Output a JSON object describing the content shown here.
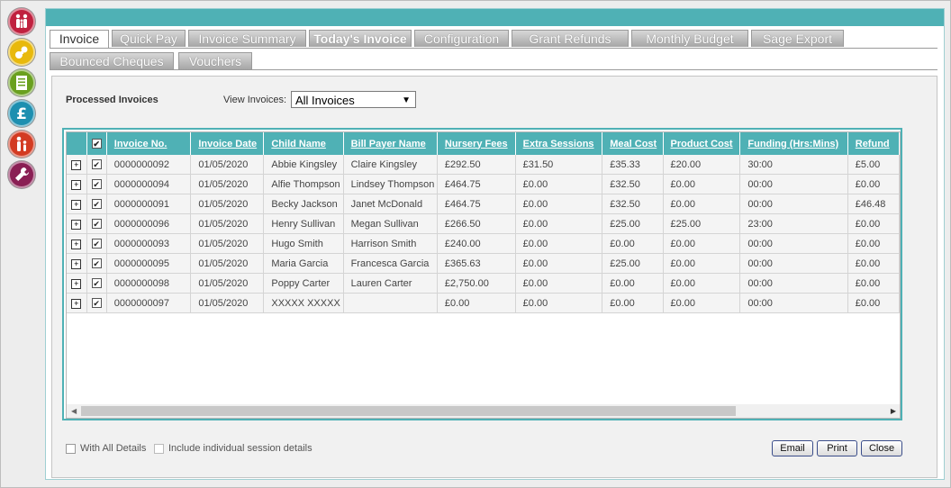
{
  "nav": [
    {
      "icon": "family-icon",
      "color": "#c0213f"
    },
    {
      "icon": "toy-icon",
      "color": "#e8b90c"
    },
    {
      "icon": "list-icon",
      "color": "#6aa01f"
    },
    {
      "icon": "pound-icon",
      "color": "#1d8fb0"
    },
    {
      "icon": "parent-child-icon",
      "color": "#d33b22"
    },
    {
      "icon": "wrench-icon",
      "color": "#8a1f54"
    }
  ],
  "tabs": {
    "invoice": "Invoice",
    "quick_pay": "Quick Pay",
    "invoice_summary": "Invoice Summary",
    "todays_invoice": "Today's Invoice",
    "configuration": "Configuration",
    "grant_refunds": "Grant Refunds",
    "monthly_budget": "Monthly Budget",
    "sage_export": "Sage Export",
    "bounced_cheques": "Bounced Cheques",
    "vouchers": "Vouchers"
  },
  "section_label": "Processed Invoices",
  "view_label": "View Invoices:",
  "view_value": "All Invoices",
  "columns": {
    "invoice_no": "Invoice No.",
    "invoice_date": "Invoice Date",
    "child_name": "Child Name",
    "bill_payer": "Bill Payer Name",
    "nursery_fees": "Nursery Fees",
    "extra_sessions": "Extra Sessions",
    "meal_cost": "Meal Cost",
    "product_cost": "Product Cost",
    "funding": "Funding (Hrs:Mins)",
    "refund": "Refund"
  },
  "rows": [
    {
      "no": "0000000092",
      "date": "01/05/2020",
      "child": "Abbie Kingsley",
      "payer": "Claire Kingsley",
      "fees": "£292.50",
      "extra": "£31.50",
      "meal": "£35.33",
      "product": "£20.00",
      "funding": "30:00",
      "refund": "£5.00"
    },
    {
      "no": "0000000094",
      "date": "01/05/2020",
      "child": "Alfie Thompson",
      "payer": "Lindsey Thompson",
      "fees": "£464.75",
      "extra": "£0.00",
      "meal": "£32.50",
      "product": "£0.00",
      "funding": "00:00",
      "refund": "£0.00"
    },
    {
      "no": "0000000091",
      "date": "01/05/2020",
      "child": "Becky Jackson",
      "payer": "Janet McDonald",
      "fees": "£464.75",
      "extra": "£0.00",
      "meal": "£32.50",
      "product": "£0.00",
      "funding": "00:00",
      "refund": "£46.48"
    },
    {
      "no": "0000000096",
      "date": "01/05/2020",
      "child": "Henry Sullivan",
      "payer": "Megan Sullivan",
      "fees": "£266.50",
      "extra": "£0.00",
      "meal": "£25.00",
      "product": "£25.00",
      "funding": "23:00",
      "refund": "£0.00"
    },
    {
      "no": "0000000093",
      "date": "01/05/2020",
      "child": "Hugo Smith",
      "payer": "Harrison Smith",
      "fees": "£240.00",
      "extra": "£0.00",
      "meal": "£0.00",
      "product": "£0.00",
      "funding": "00:00",
      "refund": "£0.00"
    },
    {
      "no": "0000000095",
      "date": "01/05/2020",
      "child": "Maria Garcia",
      "payer": "Francesca Garcia",
      "fees": "£365.63",
      "extra": "£0.00",
      "meal": "£25.00",
      "product": "£0.00",
      "funding": "00:00",
      "refund": "£0.00"
    },
    {
      "no": "0000000098",
      "date": "01/05/2020",
      "child": "Poppy Carter",
      "payer": "Lauren Carter",
      "fees": "£2,750.00",
      "extra": "£0.00",
      "meal": "£0.00",
      "product": "£0.00",
      "funding": "00:00",
      "refund": "£0.00"
    },
    {
      "no": "0000000097",
      "date": "01/05/2020",
      "child": "XXXXX XXXXX",
      "payer": "",
      "fees": "£0.00",
      "extra": "£0.00",
      "meal": "£0.00",
      "product": "£0.00",
      "funding": "00:00",
      "refund": "£0.00"
    }
  ],
  "options": {
    "with_all_details": "With All Details",
    "include_session": "Include individual session details"
  },
  "buttons": {
    "email": "Email",
    "print": "Print",
    "close": "Close"
  }
}
